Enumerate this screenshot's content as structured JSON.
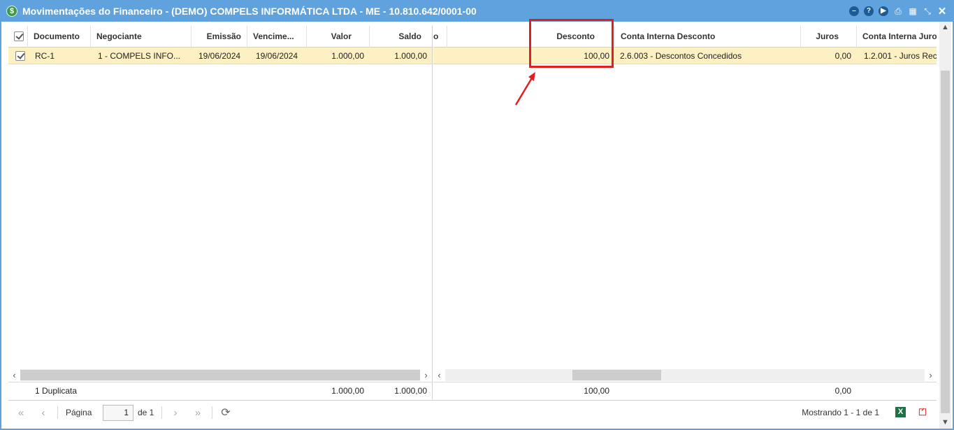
{
  "window": {
    "title": "Movimentações do Financeiro - (DEMO) COMPELS INFORMÁTICA LTDA - ME - 10.810.642/0001-00",
    "title_icon": "dollar-icon",
    "tools": [
      "minimize-icon",
      "help-icon",
      "play-icon",
      "print-icon",
      "calendar-icon",
      "collapse-icon",
      "close-icon"
    ]
  },
  "grid": {
    "locked_columns": [
      "Documento",
      "Negociante",
      "Emissão",
      "Vencime...",
      "Valor",
      "Saldo"
    ],
    "normal_columns": [
      "o",
      "Desconto",
      "Conta Interna Desconto",
      "Juros",
      "Conta Interna Juro"
    ],
    "rows": [
      {
        "documento": "RC-1",
        "negociante": "1 - COMPELS INFO...",
        "emissao": "19/06/2024",
        "vencimento": "19/06/2024",
        "valor": "1.000,00",
        "saldo": "1.000,00",
        "desconto": "100,00",
        "conta_desconto": "2.6.003 - Descontos Concedidos",
        "juros": "0,00",
        "conta_juros": "1.2.001 - Juros Rec"
      }
    ],
    "summary": {
      "label": "1 Duplicata",
      "valor": "1.000,00",
      "saldo": "1.000,00",
      "desconto": "100,00",
      "juros": "0,00"
    }
  },
  "pager": {
    "page_label": "Página",
    "page_value": "1",
    "of_label": "de 1",
    "display_text": "Mostrando 1 - 1 de 1",
    "excel_label": "X"
  },
  "colors": {
    "titlebar": "#5fa2dd",
    "selected_row": "#fdf0c3",
    "annotation": "#e02020"
  }
}
